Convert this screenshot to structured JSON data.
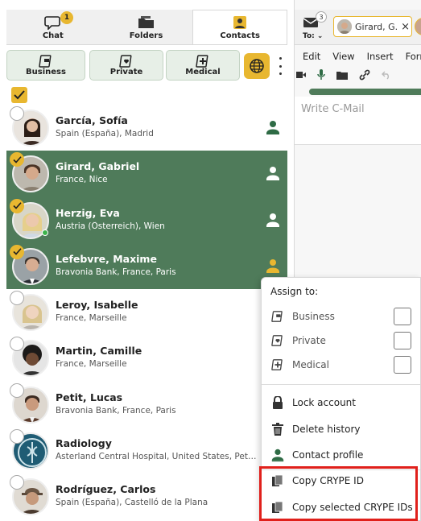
{
  "tabs": [
    {
      "label": "Chat",
      "badge": "1"
    },
    {
      "label": "Folders"
    },
    {
      "label": "Contacts"
    }
  ],
  "categories": [
    {
      "label": "Business"
    },
    {
      "label": "Private"
    },
    {
      "label": "Medical"
    }
  ],
  "contacts": [
    {
      "name": "García, Sofía",
      "sub": "Spain (España), Madrid"
    },
    {
      "name": "Girard, Gabriel",
      "sub": "France, Nice"
    },
    {
      "name": "Herzig, Eva",
      "sub": "Austria (Österreich), Wien"
    },
    {
      "name": "Lefebvre, Maxime",
      "sub": "Bravonia Bank, France, Paris"
    },
    {
      "name": "Leroy, Isabelle",
      "sub": "France, Marseille"
    },
    {
      "name": "Martin, Camille",
      "sub": "France, Marseille"
    },
    {
      "name": "Petit, Lucas",
      "sub": "Bravonia Bank, France, Paris"
    },
    {
      "name": "Radiology",
      "sub": "Asterland Central Hospital, United States, Pete..."
    },
    {
      "name": "Rodríguez, Carlos",
      "sub": "Spain (España), Castelló de la Plana"
    }
  ],
  "compose": {
    "to_label": "To:",
    "mail_badge": "3",
    "recipient_chip": "Girard, G.",
    "chip_close": "×",
    "menu": [
      "Edit",
      "View",
      "Insert",
      "Form"
    ],
    "placeholder": "Write C-Mail"
  },
  "context_menu": {
    "heading": "Assign to:",
    "assign": [
      "Business",
      "Private",
      "Medical"
    ],
    "lock": "Lock account",
    "delete": "Delete history",
    "profile": "Contact profile",
    "copy_id": "Copy CRYPE ID",
    "copy_selected": "Copy selected CRYPE IDs"
  },
  "colors": {
    "accent": "#e8b730",
    "selected_row": "#4f7b5a",
    "highlight": "#e0201b"
  }
}
